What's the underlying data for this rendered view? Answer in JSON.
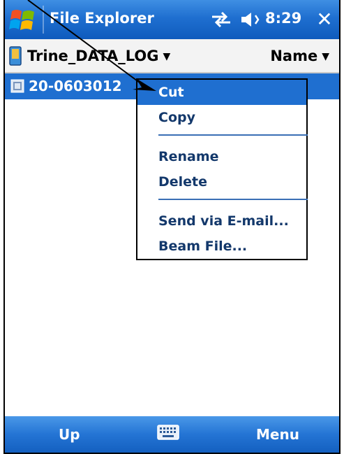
{
  "titlebar": {
    "app_title": "File Explorer",
    "clock": "8:29",
    "close_label": "✕"
  },
  "header": {
    "folder": "Trine_DATA_LOG",
    "sort": "Name"
  },
  "files": [
    {
      "name": "20-0603012"
    }
  ],
  "context_menu": {
    "items": [
      "Cut",
      "Copy",
      "Rename",
      "Delete",
      "Send via E-mail...",
      "Beam File..."
    ],
    "selected": "Cut"
  },
  "softkeys": {
    "left": "Up",
    "right": "Menu"
  },
  "colors": {
    "accent": "#1f6fd0",
    "menu_text": "#13386b"
  },
  "icons": [
    "windows-start-icon",
    "connectivity-icon",
    "volume-icon",
    "storage-card-icon",
    "file-icon",
    "keyboard-icon"
  ]
}
